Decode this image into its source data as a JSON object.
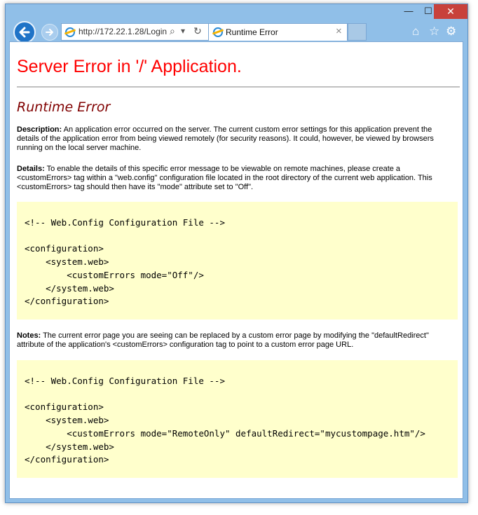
{
  "browser": {
    "address": "http://172.22.1.28/Login",
    "tab_title": "Runtime Error",
    "window_buttons": {
      "minimize": "—",
      "maximize": "☐",
      "close": "✕"
    },
    "icons": {
      "back": "back-arrow-icon",
      "forward": "forward-arrow-icon",
      "search": "⌕",
      "dropdown": "▾",
      "refresh": "↻",
      "tab_close": "×",
      "home": "⌂",
      "favorites": "☆",
      "settings": "⚙"
    }
  },
  "page": {
    "heading": "Server Error in '/' Application.",
    "subheading": "Runtime Error",
    "description_label": "Description:",
    "description_text": " An application error occurred on the server. The current custom error settings for this application prevent the details of the application error from being viewed remotely (for security reasons). It could, however, be viewed by browsers running on the local server machine.",
    "details_label": "Details:",
    "details_text": " To enable the details of this specific error message to be viewable on remote machines, please create a <customErrors> tag within a \"web.config\" configuration file located in the root directory of the current web application. This <customErrors> tag should then have its \"mode\" attribute set to \"Off\".",
    "code1": "<!-- Web.Config Configuration File -->\n\n<configuration>\n    <system.web>\n        <customErrors mode=\"Off\"/>\n    </system.web>\n</configuration>",
    "notes_label": "Notes:",
    "notes_text": " The current error page you are seeing can be replaced by a custom error page by modifying the \"defaultRedirect\" attribute of the application's <customErrors> configuration tag to point to a custom error page URL.",
    "code2": "<!-- Web.Config Configuration File -->\n\n<configuration>\n    <system.web>\n        <customErrors mode=\"RemoteOnly\" defaultRedirect=\"mycustompage.htm\"/>\n    </system.web>\n</configuration>"
  },
  "colors": {
    "heading": "#ff0000",
    "subheading": "#800000",
    "code_bg": "#ffffcc",
    "frame": "#90bfe8"
  }
}
